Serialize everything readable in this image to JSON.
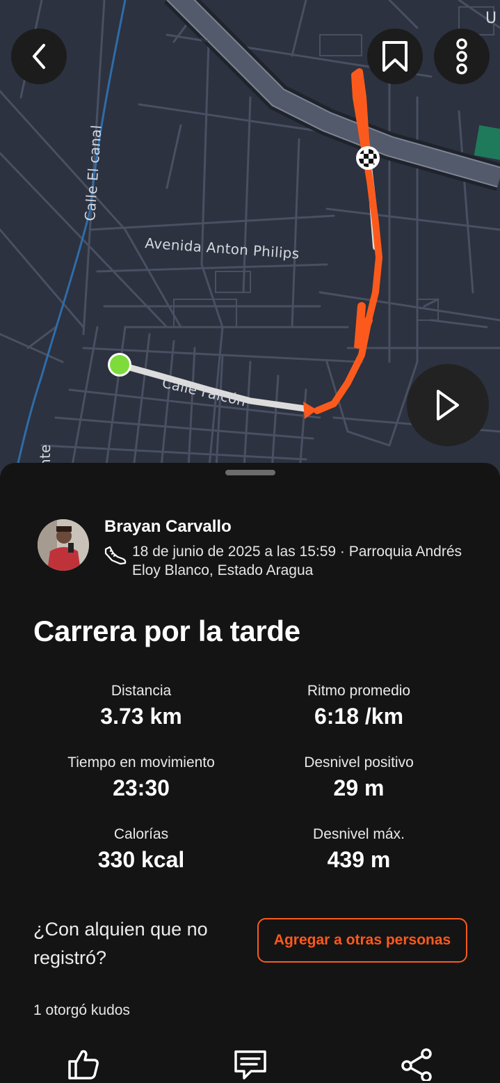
{
  "map": {
    "street_labels": [
      "Calle El canal",
      "Avenida Anton Philips",
      "Calle Falcón",
      "nte",
      "U"
    ],
    "route_color": "#fc5a1c",
    "start_color": "#7ddc3c"
  },
  "controls": {
    "back_icon": "chevron-left-icon",
    "bookmark_icon": "bookmark-icon",
    "more_icon": "more-vertical-icon",
    "play_icon": "play-icon"
  },
  "athlete": {
    "name": "Brayan Carvallo",
    "meta": "18 de junio de 2025 a las 15:59 · Parroquia Andrés Eloy Blanco, Estado Aragua",
    "activity_icon": "running-shoe-icon"
  },
  "activity": {
    "title": "Carrera por la tarde"
  },
  "stats": [
    {
      "label": "Distancia",
      "value": "3.73 km"
    },
    {
      "label": "Ritmo promedio",
      "value": "6:18 /km"
    },
    {
      "label": "Tiempo en movimiento",
      "value": "23:30"
    },
    {
      "label": "Desnivel positivo",
      "value": "29 m"
    },
    {
      "label": "Calorías",
      "value": "330 kcal"
    },
    {
      "label": "Desnivel máx.",
      "value": "439 m"
    }
  ],
  "others": {
    "question": "¿Con alquien que no registró?",
    "button": "Agregar a otras personas"
  },
  "kudos": {
    "text": "1 otorgó kudos"
  },
  "actions": [
    "thumbs-up-icon",
    "comment-icon",
    "share-icon"
  ],
  "colors": {
    "accent": "#fc5a1c",
    "sheet_bg": "#141414",
    "map_bg": "#2c323f"
  }
}
